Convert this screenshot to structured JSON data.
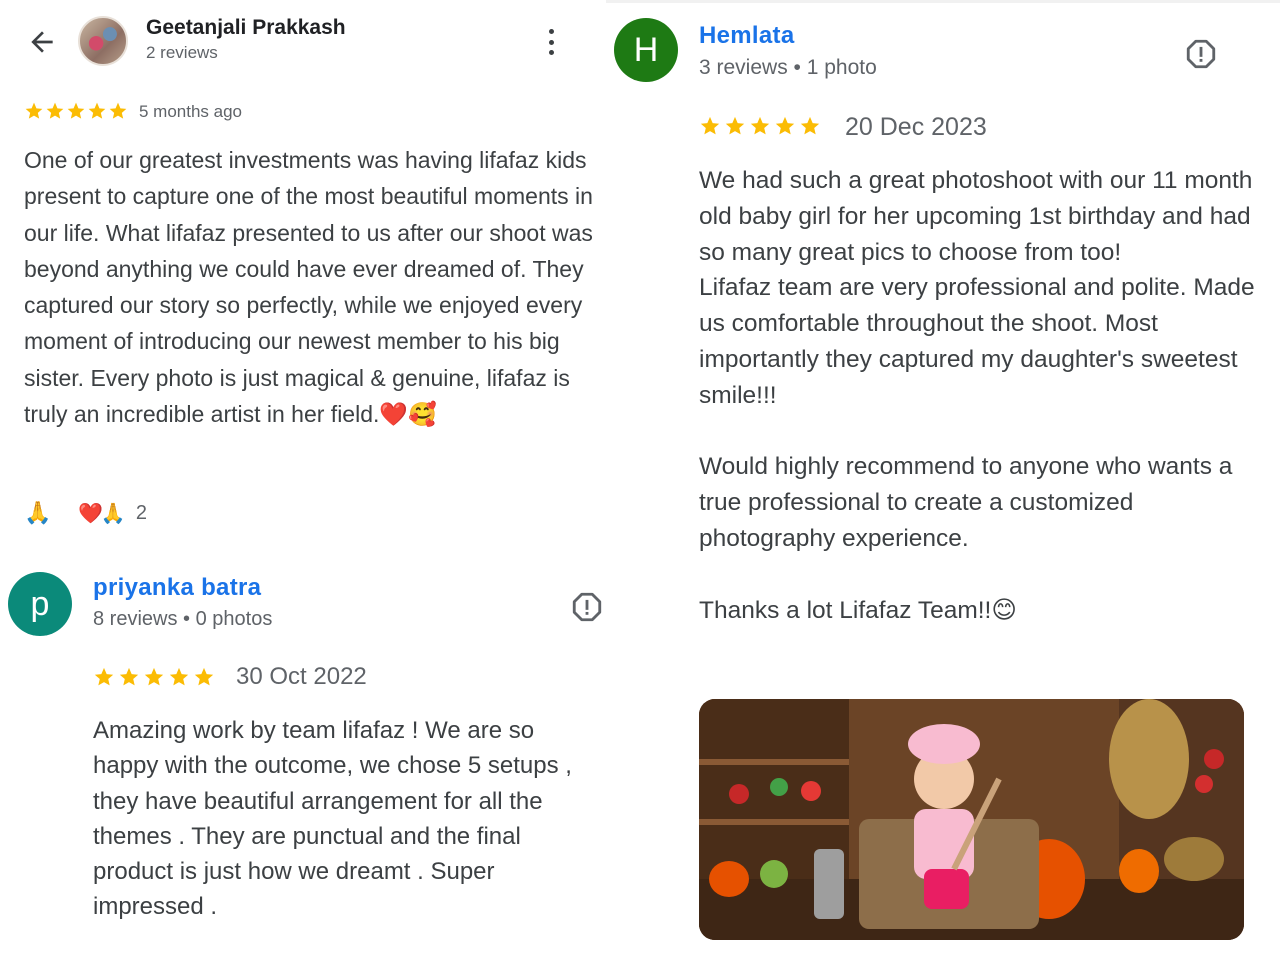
{
  "review1": {
    "author": "Geetanjali Prakkash",
    "meta": "2 reviews",
    "rating": 5,
    "date": "5 months ago",
    "text": "One of our greatest investments was having lifafaz kids present to capture one of the most beautiful moments in our life. What lifafaz presented to us after our shoot was beyond anything we could have ever dreamed of. They captured our story so perfectly, while we enjoyed every moment of introducing our newest member to his big sister. Every photo is just magical & genuine, lifafaz is truly an incredible artist in her field.❤️🥰",
    "reaction_button": "🙏",
    "reactions": "❤️🙏",
    "reaction_count": "2"
  },
  "review2": {
    "initial": "p",
    "author": "priyanka batra",
    "meta": "8 reviews • 0 photos",
    "rating": 5,
    "date": "30 Oct 2022",
    "text": "Amazing work by team lifafaz ! We are so happy with the outcome, we chose 5 setups , they have beautiful arrangement for all the themes . They are punctual and the final product is just how we dreamt . Super impressed ."
  },
  "review3": {
    "initial": "H",
    "author": "Hemlata",
    "meta": "3 reviews • 1 photo",
    "rating": 5,
    "date": "20 Dec 2023",
    "text": "We had such a great photoshoot with our 11 month old baby girl for her upcoming 1st birthday and had so many great pics to choose from too!\nLifafaz team are very professional and polite. Made us comfortable throughout the shoot. Most importantly they captured my daughter's sweetest smile!!!\n\nWould highly recommend to anyone who wants a true professional to create a customized photography experience.\n\nThanks a lot Lifafaz Team!!😊"
  },
  "icons": {
    "back": "arrow-left-icon",
    "more": "more-vertical-icon",
    "report": "report-flag-icon",
    "star": "star-icon"
  },
  "colors": {
    "star": "#fbbc04",
    "link": "#1a73e8",
    "avatar_p": "#0b8a7a",
    "avatar_h": "#1e7a14"
  }
}
